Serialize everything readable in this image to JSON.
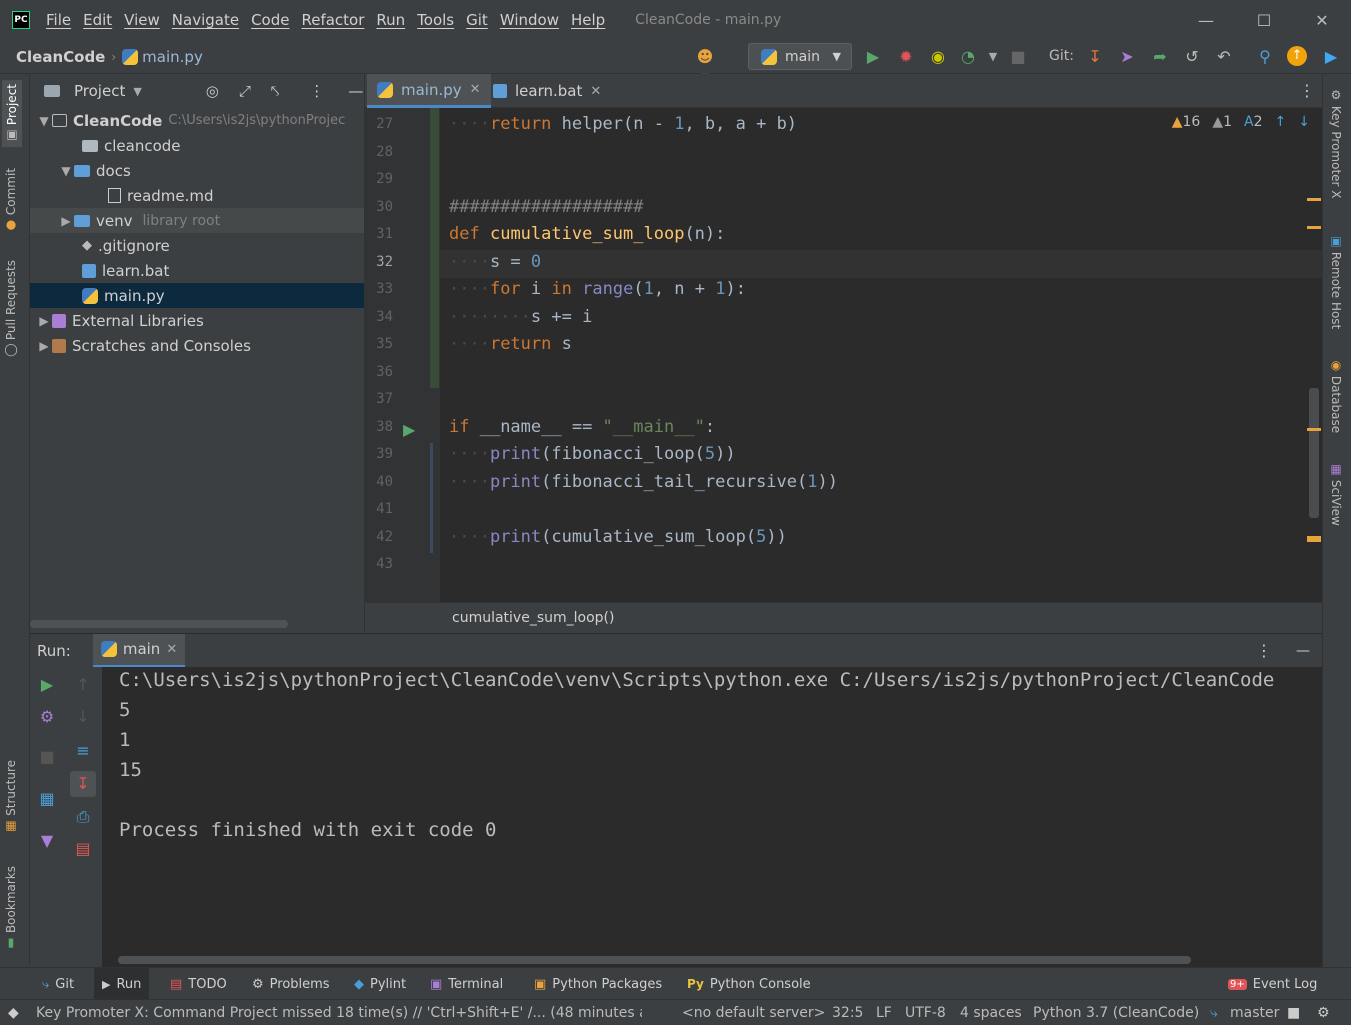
{
  "window": {
    "title": "CleanCode - main.py"
  },
  "menu": [
    "File",
    "Edit",
    "View",
    "Navigate",
    "Code",
    "Refactor",
    "Run",
    "Tools",
    "Git",
    "Window",
    "Help"
  ],
  "nav": {
    "project": "CleanCode",
    "file": "main.py",
    "run_config": "main",
    "git_label": "Git:"
  },
  "left_tabs": {
    "project": "Project",
    "commit": "Commit",
    "pull_requests": "Pull Requests",
    "structure": "Structure",
    "bookmarks": "Bookmarks"
  },
  "right_tabs": {
    "key_promoter": "Key Promoter X",
    "remote_host": "Remote Host",
    "database": "Database",
    "sciview": "SciView"
  },
  "project": {
    "header": "Project",
    "root": {
      "name": "CleanCode",
      "path": "C:\\Users\\is2js\\pythonProjec"
    },
    "items": [
      {
        "label": "cleancode"
      },
      {
        "label": "docs"
      },
      {
        "label": "readme.md"
      },
      {
        "label": "venv",
        "note": "library root"
      },
      {
        "label": ".gitignore"
      },
      {
        "label": "learn.bat"
      },
      {
        "label": "main.py"
      },
      {
        "label": "External Libraries"
      },
      {
        "label": "Scratches and Consoles"
      }
    ]
  },
  "editor": {
    "tabs": [
      {
        "label": "main.py"
      },
      {
        "label": "learn.bat"
      }
    ],
    "line_numbers": [
      "27",
      "28",
      "29",
      "30",
      "31",
      "32",
      "33",
      "34",
      "35",
      "36",
      "37",
      "38",
      "39",
      "40",
      "41",
      "42",
      "43"
    ],
    "inspections": {
      "warnings": "16",
      "weak_warnings": "1",
      "typos": "2"
    },
    "breadcrumb": "cumulative_sum_loop()",
    "current_line": 32
  },
  "run": {
    "label": "Run:",
    "tab": "main",
    "output": [
      "C:\\Users\\is2js\\pythonProject\\CleanCode\\venv\\Scripts\\python.exe C:/Users/is2js/pythonProject/CleanCode",
      "5",
      "1",
      "15",
      "",
      "Process finished with exit code 0"
    ]
  },
  "tool_tabs": [
    {
      "label": "Git"
    },
    {
      "label": "Run"
    },
    {
      "label": "TODO"
    },
    {
      "label": "Problems"
    },
    {
      "label": "Pylint"
    },
    {
      "label": "Terminal"
    },
    {
      "label": "Python Packages"
    },
    {
      "label": "Python Console"
    },
    {
      "label": "Event Log",
      "badge": "9+"
    }
  ],
  "status": {
    "message": "Key Promoter X: Command Project missed 18 time(s) // 'Ctrl+Shift+E' /... (48 minutes agc",
    "server": "<no default server>",
    "position": "32:5",
    "line_sep": "LF",
    "encoding": "UTF-8",
    "indent": "4 spaces",
    "interpreter": "Python 3.7 (CleanCode)",
    "branch": "master"
  },
  "colors": {
    "accent": "#4a88c7",
    "background": "#2b2b2b",
    "panel": "#3c3f41",
    "keyword": "#cc7832",
    "function": "#ffc66d",
    "number": "#6897bb"
  }
}
